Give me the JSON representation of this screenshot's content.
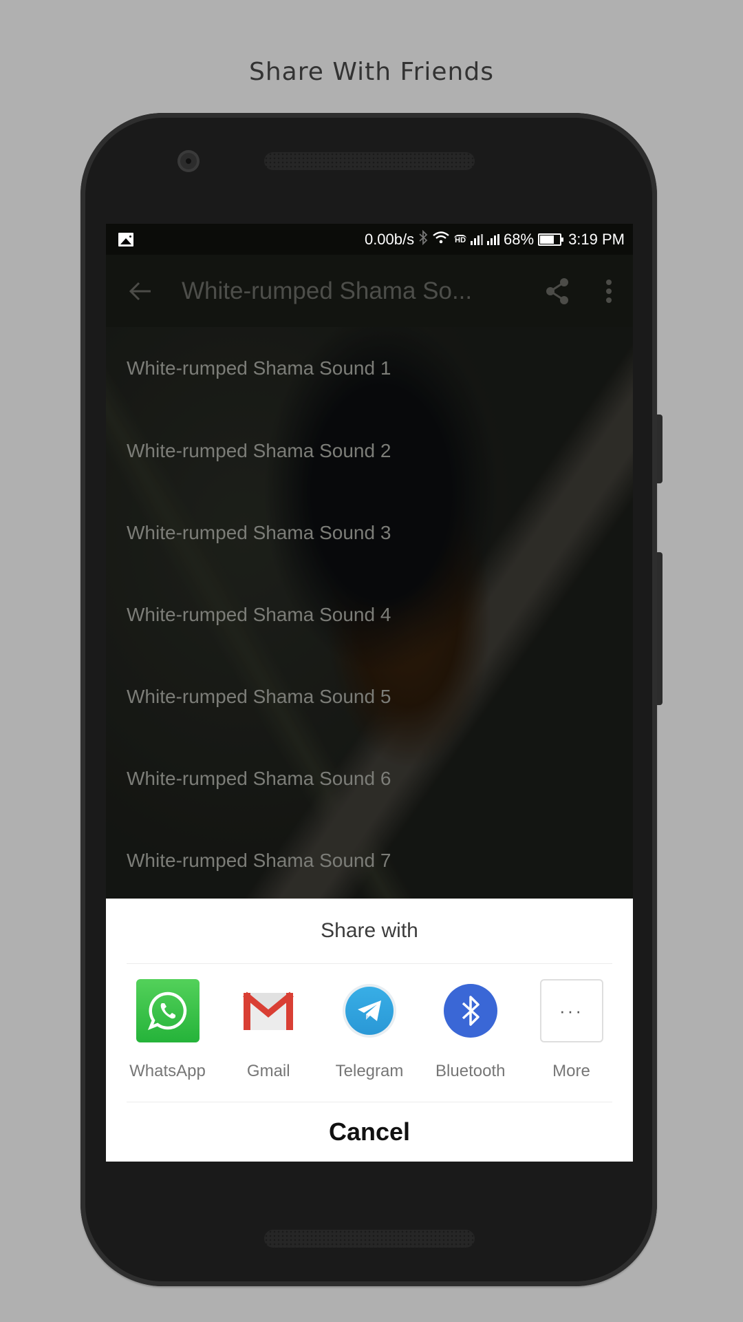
{
  "promo": {
    "title": "Share With Friends"
  },
  "status_bar": {
    "notification_icon": "image-icon",
    "network_speed": "0.00b/s",
    "icons": [
      "bluetooth-icon",
      "wifi-icon",
      "hd-call-icon",
      "signal-icon",
      "signal-icon"
    ],
    "battery": "68%",
    "battery_level": 0.68,
    "time": "3:19 PM"
  },
  "app_bar": {
    "back_icon": "arrow-left-icon",
    "title": "White-rumped Shama So...",
    "share_icon": "share-icon",
    "menu_icon": "more-vert-icon"
  },
  "sound_list": [
    {
      "label": "White-rumped Shama Sound 1"
    },
    {
      "label": "White-rumped Shama Sound 2"
    },
    {
      "label": "White-rumped Shama Sound 3"
    },
    {
      "label": "White-rumped Shama Sound 4"
    },
    {
      "label": "White-rumped Shama Sound 5"
    },
    {
      "label": "White-rumped Shama Sound 6"
    },
    {
      "label": "White-rumped Shama Sound 7"
    }
  ],
  "share_sheet": {
    "title": "Share with",
    "apps": [
      {
        "label": "WhatsApp",
        "icon": "whatsapp-icon",
        "color": "#2fbc3f"
      },
      {
        "label": "Gmail",
        "icon": "gmail-icon",
        "color": "#d93f34"
      },
      {
        "label": "Telegram",
        "icon": "telegram-icon",
        "color": "#2ea6df"
      },
      {
        "label": "Bluetooth",
        "icon": "bluetooth-icon",
        "color": "#3a67d6"
      },
      {
        "label": "More",
        "icon": "more-horiz-icon",
        "glyph": "···"
      }
    ],
    "cancel_label": "Cancel"
  }
}
